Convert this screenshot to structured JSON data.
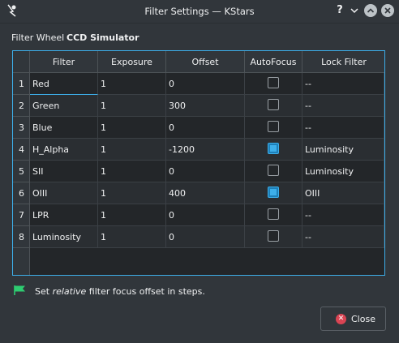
{
  "window": {
    "title": "Filter Settings — KStars",
    "help_glyph": "?",
    "min_glyph": "⌵"
  },
  "filter_wheel": {
    "label": "Filter Wheel",
    "value": "CCD Simulator"
  },
  "table": {
    "columns": [
      "Filter",
      "Exposure",
      "Offset",
      "AutoFocus",
      "Lock Filter"
    ],
    "rows": [
      {
        "num": "1",
        "filter": "Red",
        "exposure": "1",
        "offset": "0",
        "autofocus": false,
        "lock": "--"
      },
      {
        "num": "2",
        "filter": "Green",
        "exposure": "1",
        "offset": "300",
        "autofocus": false,
        "lock": "--"
      },
      {
        "num": "3",
        "filter": "Blue",
        "exposure": "1",
        "offset": "0",
        "autofocus": false,
        "lock": "--"
      },
      {
        "num": "4",
        "filter": "H_Alpha",
        "exposure": "1",
        "offset": "-1200",
        "autofocus": true,
        "lock": "Luminosity"
      },
      {
        "num": "5",
        "filter": "SII",
        "exposure": "1",
        "offset": "0",
        "autofocus": false,
        "lock": "Luminosity"
      },
      {
        "num": "6",
        "filter": "OIII",
        "exposure": "1",
        "offset": "400",
        "autofocus": true,
        "lock": "OIII"
      },
      {
        "num": "7",
        "filter": "LPR",
        "exposure": "1",
        "offset": "0",
        "autofocus": false,
        "lock": "--"
      },
      {
        "num": "8",
        "filter": "Luminosity",
        "exposure": "1",
        "offset": "0",
        "autofocus": false,
        "lock": "--"
      }
    ]
  },
  "hint": {
    "before": "Set ",
    "emphasis": "relative",
    "after": " filter focus offset in steps.",
    "icon": "green-flag-icon"
  },
  "buttons": {
    "close_label": "Close",
    "close_icon": "close-circle-icon"
  },
  "colors": {
    "accent": "#3daee9",
    "close_icon": "#da4453",
    "flag": "#2ecc71"
  }
}
